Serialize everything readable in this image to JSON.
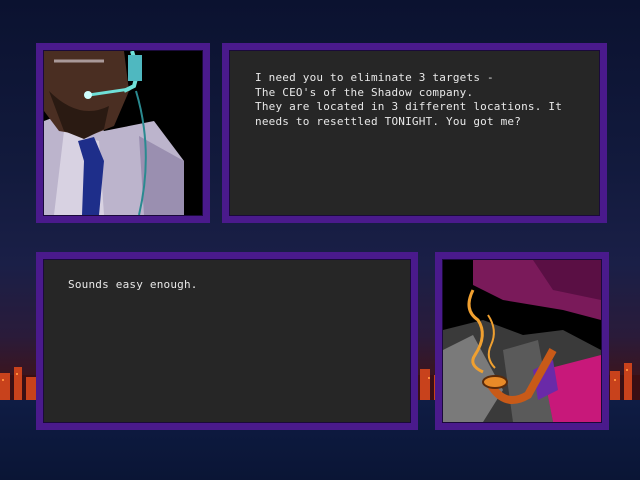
{
  "scene": {
    "top_speaker": {
      "portrait_icon": "man-with-headset-portrait",
      "dialog": "I need you to eliminate 3 targets -\nThe CEO's of the Shadow company.\nThey are located in 3 different locations. It\nneeds to resettled TONIGHT. You got me?"
    },
    "bottom_speaker": {
      "portrait_icon": "hat-and-pipe-agent-portrait",
      "dialog": "Sounds easy enough."
    }
  },
  "colors": {
    "panel_border": "#4a1a8c",
    "panel_fill": "#262626",
    "text": "#e8e8e8"
  }
}
